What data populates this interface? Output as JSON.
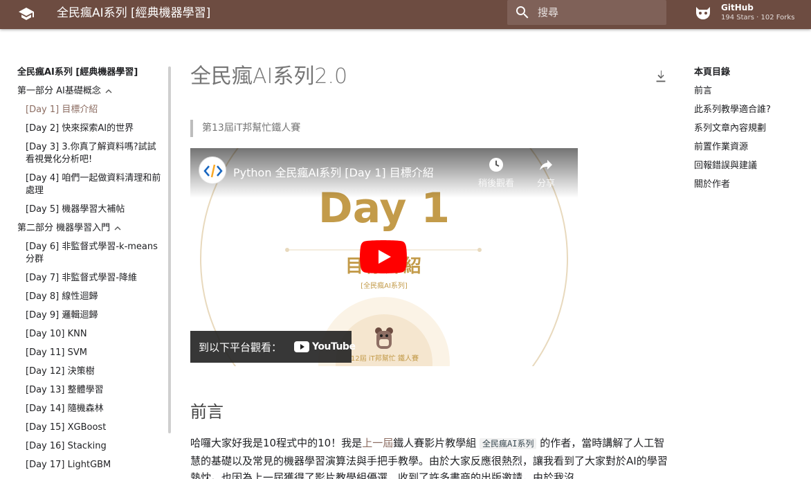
{
  "header": {
    "site_title": "全民瘋AI系列 [經典機器學習]",
    "search_placeholder": "搜尋",
    "repo_name": "GitHub",
    "repo_facts": "194 Stars · 102 Forks",
    "bar_color": "#6d4c41"
  },
  "nav": {
    "title": "全民瘋AI系列 [經典機器學習]",
    "sections": [
      {
        "label": "第一部分 AI基礎概念",
        "items": [
          {
            "label": "[Day 1] 目標介紹",
            "active": true
          },
          {
            "label": "[Day 2] 快來探索AI的世界"
          },
          {
            "label": "[Day 3] 3.你真了解資料嗎?試試看視覺化分析吧!"
          },
          {
            "label": "[Day 4] 咱們一起做資料清理和前處理"
          },
          {
            "label": "[Day 5] 機器學習大補帖"
          }
        ]
      },
      {
        "label": "第二部分 機器學習入門",
        "items": [
          {
            "label": "[Day 6] 非監督式學習-k-means分群"
          },
          {
            "label": "[Day 7] 非監督式學習-降維"
          },
          {
            "label": "[Day 8] 線性迴歸"
          },
          {
            "label": "[Day 9] 邏輯迴歸"
          },
          {
            "label": "[Day 10] KNN"
          },
          {
            "label": "[Day 11] SVM"
          },
          {
            "label": "[Day 12] 決策樹"
          },
          {
            "label": "[Day 13] 整體學習"
          },
          {
            "label": "[Day 14] 隨機森林"
          },
          {
            "label": "[Day 15] XGBoost"
          },
          {
            "label": "[Day 16] Stacking"
          },
          {
            "label": "[Day 17] LightGBM"
          }
        ]
      }
    ],
    "active_color": "#8d6e63"
  },
  "main": {
    "page_title": "全民瘋AI系列2.0",
    "quote": "第13屆iT邦幫忙鐵人賽",
    "video": {
      "title": "Python 全民瘋AI系列 [Day 1] 目標介紹",
      "watch_later": "稍後觀看",
      "share": "分享",
      "thumb_day": "Day 1",
      "thumb_goal": "目標介紹",
      "thumb_tag": "[全民瘋AI系列]",
      "thumb_footer": "12屆 iT邦幫忙 鐵人賽",
      "watch_on": "到以下平台觀看：",
      "youtube": "YouTube"
    },
    "section_title": "前言",
    "para": {
      "p1": "哈囉大家好我是10程式中的10！我是",
      "link": "上一屆",
      "p2": "鐵人賽影片教學組",
      "code": "全民瘋AI系列",
      "p3": "的作者，當時講解了人工智慧的基礎以及常見的機器學習演算法與手把手教學。由於大家反應很熱烈，讓我看到了大家對於AI的學習熱忱。也因為上一屆獲得了影片教學組優選，收到了許多書商的出版邀請，由於我沒"
    }
  },
  "toc": {
    "title": "本頁目錄",
    "items": [
      "前言",
      "此系列教學適合誰?",
      "系列文章內容規劃",
      "前置作業資源",
      "回報錯誤與建議",
      "關於作者"
    ]
  }
}
